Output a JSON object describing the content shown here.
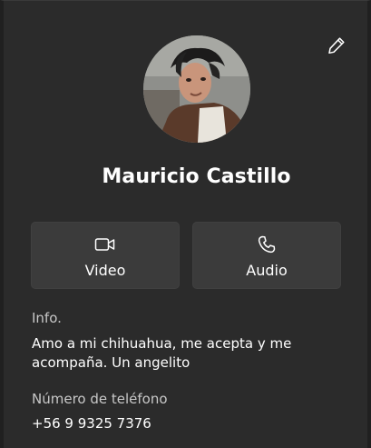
{
  "contact": {
    "name": "Mauricio Castillo"
  },
  "actions": {
    "video_label": "Video",
    "audio_label": "Audio"
  },
  "info": {
    "label": "Info.",
    "value": "Amo a mi chihuahua, me acepta y me acompaña. Un angelito"
  },
  "phone": {
    "label": "Número de teléfono",
    "value": "+56 9 9325 7376"
  },
  "icons": {
    "edit": "pencil-icon",
    "video": "video-camera-icon",
    "audio": "phone-icon"
  },
  "colors": {
    "background": "#2b2b2b",
    "button": "#3b3b3b",
    "text": "#ffffff",
    "muted_text": "#c8c8c8"
  }
}
